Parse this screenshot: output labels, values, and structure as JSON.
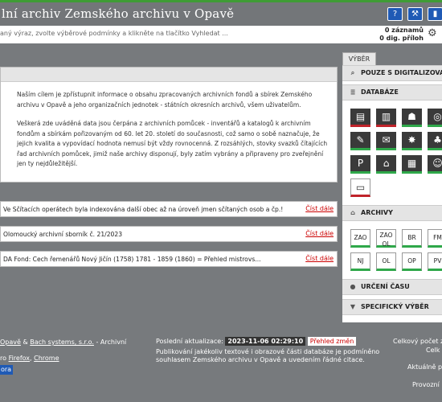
{
  "header": {
    "title": "lní archiv  Zemského archivu v Opavě",
    "buttons": [
      {
        "name": "help",
        "glyph": "?"
      },
      {
        "name": "tools",
        "glyph": "⚒"
      },
      {
        "name": "stats",
        "glyph": "▮"
      }
    ]
  },
  "search": {
    "hint": "aný výraz, zvolte výběrové podmínky a klikněte na tlačítko Vyhledat ...",
    "records": "0 záznamů",
    "attachments": "0 dig. příloh"
  },
  "intro": {
    "p1": "Naším cílem je zpřístupnit informace o obsahu zpracovaných archivních fondů a sbírek Zemského archivu v Opavě a jeho organizačních jednotek - státních okresních archivů, všem uživatelům.",
    "p2": "Veškerá zde uváděná data jsou čerpána z archivních pomůcek - inventářů a katalogů k archivním fondům a sbírkám pořizovaným od 60. let 20. století do současnosti, což samo o sobě naznačuje, že jejich kvalita a vypovídací hodnota nemusí být vždy rovnocenná. Z rozsáhlých, stovky svazků čítajících řad archivních pomůcek, jimiž naše archivy disponují, byly zatím vybrány a připraveny pro zveřejnění jen ty nejdůležitější."
  },
  "news": [
    {
      "text": "Ve Sčítacích operátech byla indexována další obec až na úroveň jmen sčítaných osob a čp.!",
      "link": "Číst dále"
    },
    {
      "text": "Olomoucký archivní sborník č. 21/2023",
      "link": "Číst dále"
    },
    {
      "text": "DA Fond: Cech řemenářů Nový Jičín (1758) 1781 - 1859 (1860) = Přehled mistrovs...",
      "link": "Číst dále"
    }
  ],
  "panel": {
    "tab_label": "VÝBĚR",
    "digitized_label": "POUZE S DIGITALIZOVAN",
    "databases_label": "DATABÁZE",
    "archives_label": "ARCHIVY",
    "time_label": "URČENÍ ČASU",
    "specific_label": "SPECIFICKÝ VÝBĚR",
    "db_icons": [
      {
        "name": "ledger-icon",
        "glyph": "▤",
        "style": "red"
      },
      {
        "name": "document-icon",
        "glyph": "▥",
        "style": "red"
      },
      {
        "name": "person-desk-icon",
        "glyph": "☗",
        "style": "green"
      },
      {
        "name": "camera-icon",
        "glyph": "◎",
        "style": "green"
      },
      {
        "name": "feather-icon",
        "glyph": "✎",
        "style": "green"
      },
      {
        "name": "scroll-icon",
        "glyph": "✉",
        "style": "green"
      },
      {
        "name": "star-icon",
        "glyph": "✸",
        "style": "green"
      },
      {
        "name": "tree-icon",
        "glyph": "♣",
        "style": "green"
      },
      {
        "name": "parking-icon",
        "glyph": "P",
        "style": "green"
      },
      {
        "name": "house-icon",
        "glyph": "⌂",
        "style": "green"
      },
      {
        "name": "building-icon",
        "glyph": "▦",
        "style": "green"
      },
      {
        "name": "people-icon",
        "glyph": "☺",
        "style": "green"
      },
      {
        "name": "book-icon",
        "glyph": "▭",
        "style": "light"
      }
    ],
    "archives": [
      [
        "ZAO"
      ],
      [
        "ZAO",
        "OL"
      ],
      [
        "BR"
      ],
      [
        "FM"
      ],
      [
        "NJ"
      ],
      [
        "OL"
      ],
      [
        "OP"
      ],
      [
        "PV"
      ]
    ]
  },
  "footer": {
    "owner_link": "Opavě",
    "and": " & ",
    "vendor_link": "Bach systems, s.r.o.",
    "suffix": " - Archivní",
    "browser_prefix": "ro ",
    "firefox": "Firefox",
    "comma": ", ",
    "chrome": "Chrome",
    "opera": "ora",
    "updated_label": "Poslední aktualizace:",
    "updated_date": "2023-11-06 02:29:10",
    "changes_link": "Přehled změn",
    "notice_line1": "Publikování jakékoliv textové i obrazové části databáze je podmíněno",
    "notice_line2": "souhlasem Zemského archivu v Opavě a uvedením řádné citace.",
    "right1": "Celkový počet z",
    "right2": "Celk",
    "right3": "Aktuálně p",
    "right4": "Provozní"
  }
}
